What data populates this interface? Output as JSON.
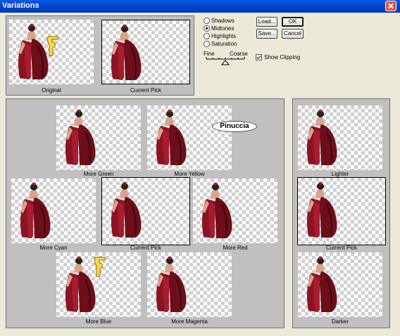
{
  "window": {
    "title": "Variations"
  },
  "top": {
    "original_label": "Original",
    "current_pick_label": "Current Pick"
  },
  "tones": {
    "options": [
      "Shadows",
      "Midtones",
      "Highlights",
      "Saturation"
    ],
    "selected": "Midtones"
  },
  "slider": {
    "fine_label": "Fine",
    "coarse_label": "Coarse"
  },
  "buttons": {
    "load": "Load...",
    "save": "Save...",
    "ok": "OK",
    "cancel": "Cancel"
  },
  "show_clipping": {
    "label": "Show Clipping",
    "checked": true
  },
  "color_grid": {
    "more_green": "More Green",
    "more_yellow": "More Yellow",
    "more_cyan": "More Cyan",
    "current_pick": "Current Pick",
    "more_red": "More Red",
    "more_blue": "More Blue",
    "more_magenta": "More Magenta"
  },
  "brightness": {
    "lighter": "Lighter",
    "current_pick": "Current Pick",
    "darker": "Darker"
  },
  "watermark": {
    "text": "Pinuccia"
  },
  "colors": {
    "titlebar": "#0a58e4",
    "dialog": "#ece9d8",
    "panel": "#c0c0c0",
    "dress": "#7a1020"
  }
}
